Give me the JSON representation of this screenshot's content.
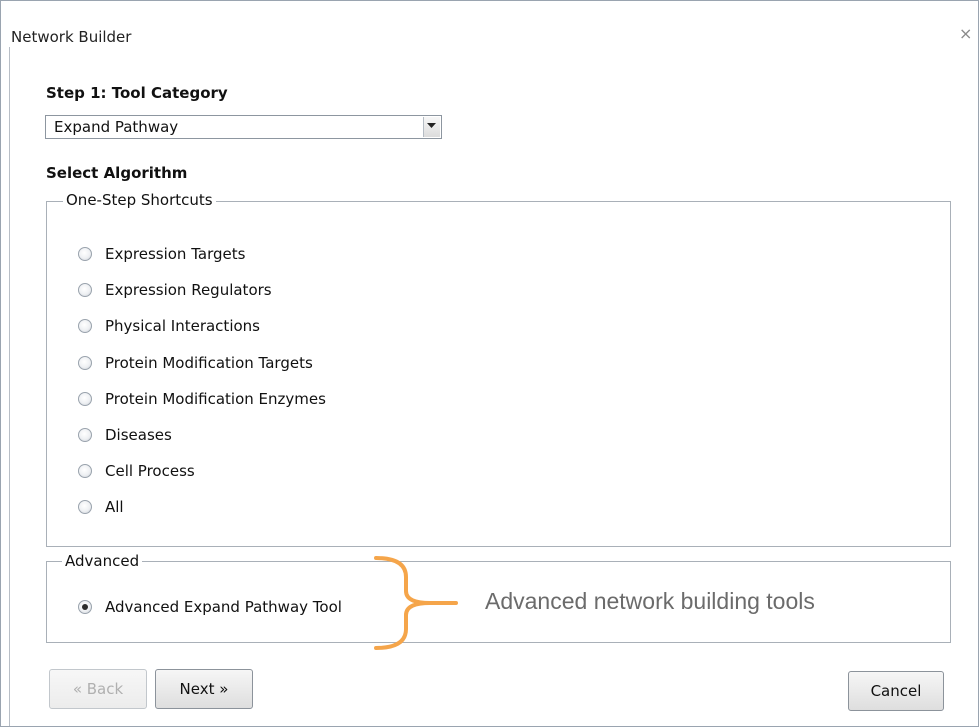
{
  "window": {
    "title": "Network Builder",
    "close_glyph": "×"
  },
  "step1": {
    "heading": "Step 1: Tool Category",
    "selected_value": "Expand Pathway"
  },
  "algorithm": {
    "heading": "Select Algorithm",
    "shortcuts_group": {
      "label": "One-Step Shortcuts",
      "options": [
        {
          "label": "Expression Targets",
          "checked": false
        },
        {
          "label": "Expression Regulators",
          "checked": false
        },
        {
          "label": "Physical Interactions",
          "checked": false
        },
        {
          "label": "Protein Modification Targets",
          "checked": false
        },
        {
          "label": "Protein Modification Enzymes",
          "checked": false
        },
        {
          "label": "Diseases",
          "checked": false
        },
        {
          "label": "Cell Process",
          "checked": false
        },
        {
          "label": "All",
          "checked": false
        }
      ]
    },
    "advanced_group": {
      "label": "Advanced",
      "options": [
        {
          "label": "Advanced Expand Pathway Tool",
          "checked": true
        }
      ]
    }
  },
  "annotation": {
    "text": "Advanced network building tools",
    "bracket_color": "#f5a54a"
  },
  "buttons": {
    "back": "« Back",
    "next": "Next »",
    "cancel": "Cancel"
  }
}
